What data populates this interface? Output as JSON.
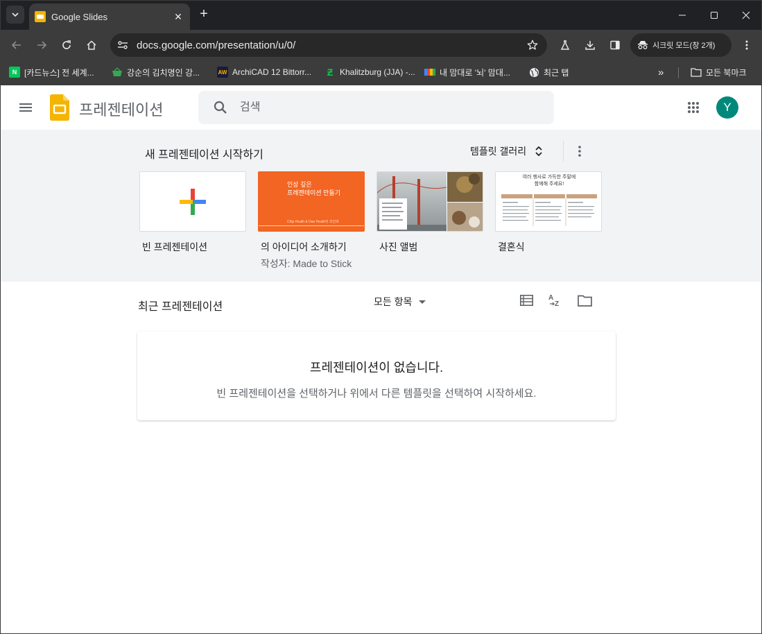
{
  "browser": {
    "tab_title": "Google Slides",
    "url": "docs.google.com/presentation/u/0/",
    "incognito_label": "시크릿 모드(창 2개)"
  },
  "bookmarks": [
    {
      "label": "[카드뉴스] 전 세계...",
      "icon": "naver-icon",
      "color": "#03c75a"
    },
    {
      "label": "강순의 김치명인 강...",
      "icon": "basket-icon",
      "color": "#34a853"
    },
    {
      "label": "ArchiCAD 12 Bittorr...",
      "icon": "aw-icon",
      "color": "#1a1a40"
    },
    {
      "label": "Khalitzburg (JJA) -...",
      "icon": "deviantart-icon",
      "color": "#05cc47"
    },
    {
      "label": "내 맘대로 '뇌' 맘대...",
      "icon": "colorbar-icon",
      "color": "#4285f4"
    },
    {
      "label": "최근 탭",
      "icon": "globe-icon",
      "color": "#e8eaed"
    }
  ],
  "bookmarks_more": "»",
  "all_bookmarks": "모든 북마크",
  "app": {
    "title": "프레젠테이션",
    "search_placeholder": "검색",
    "avatar_letter": "Y"
  },
  "templates": {
    "heading": "새 프레젠테이션 시작하기",
    "gallery_label": "템플릿 갤러리",
    "items": [
      {
        "name": "빈 프레젠테이션",
        "sub": ""
      },
      {
        "name": "의 아이디어 소개하기",
        "sub": "작성자: Made to Stick"
      },
      {
        "name": "사진 앨범",
        "sub": ""
      },
      {
        "name": "결혼식",
        "sub": ""
      }
    ],
    "thumb_idea_title": "인상 깊은\n프레젠테이션 만들기",
    "thumb_idea_footer": "Chip Heath & Dan Heath의 조언과",
    "thumb_wedding_title": "여러 행사로 가득한 주말에\n함께해 주세요!"
  },
  "recent": {
    "title": "최근 프레젠테이션",
    "owner_filter": "모든 항목",
    "empty_title": "프레젠테이션이 없습니다.",
    "empty_sub": "빈 프레젠테이션을 선택하거나 위에서 다른 템플릿을 선택하여 시작하세요."
  },
  "colors": {
    "slides_yellow": "#f4b400",
    "avatar": "#00897b",
    "idea_orange": "#f26522",
    "wedding_tan": "#c9a27e"
  }
}
